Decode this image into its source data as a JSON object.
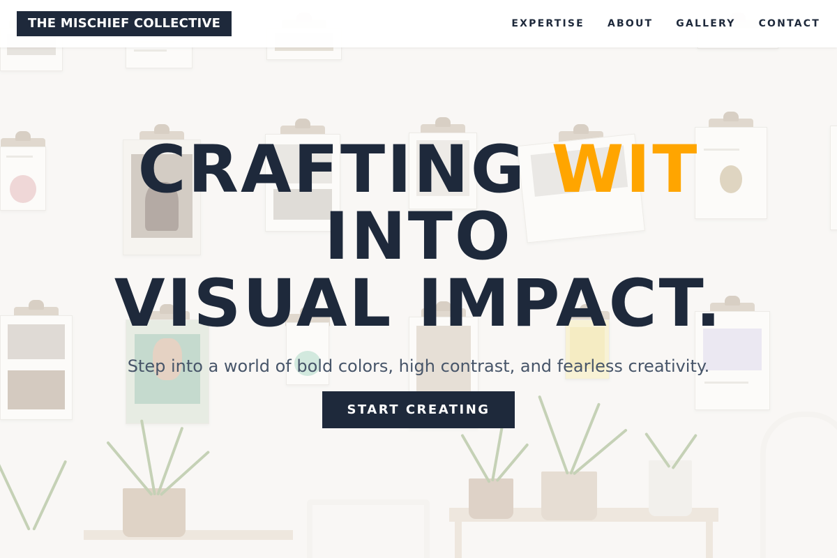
{
  "header": {
    "logo_text": "THE MISCHIEF COLLECTIVE",
    "nav": [
      {
        "label": "EXPERTISE"
      },
      {
        "label": "ABOUT"
      },
      {
        "label": "GALLERY"
      },
      {
        "label": "CONTACT"
      }
    ]
  },
  "hero": {
    "headline_part1": "CRAFTING ",
    "headline_accent": "WIT",
    "headline_line2": "INTO",
    "headline_line3": "VISUAL IMPACT.",
    "subtitle": "Step into a world of bold colors, high contrast, and fearless creativity.",
    "cta_label": "START CREATING",
    "background_image": "wall-of-clipboards-and-plants-photo"
  },
  "colors": {
    "primary_dark": "#1e293b",
    "accent": "#ffa500",
    "subtitle_text": "#475569",
    "header_bg": "#ffffff"
  }
}
